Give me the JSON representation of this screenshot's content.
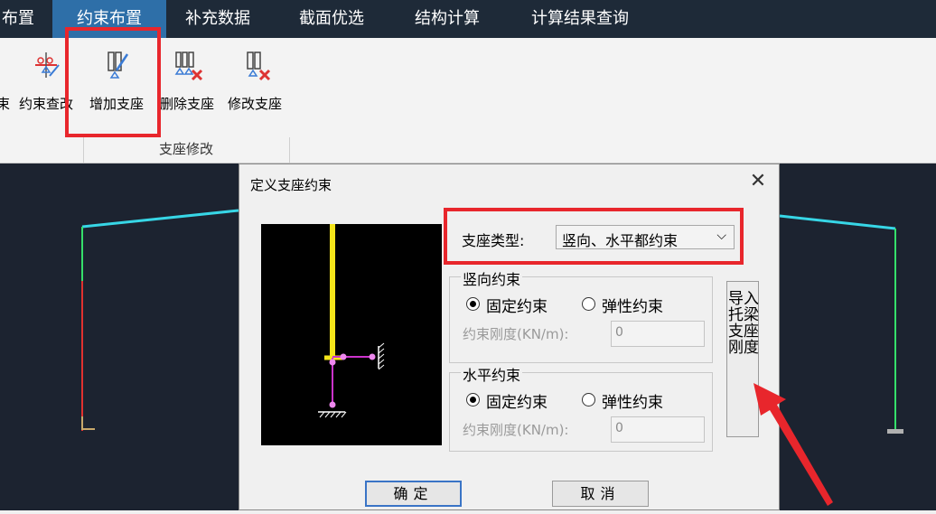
{
  "menubar": {
    "tabs": [
      {
        "label": "布置"
      },
      {
        "label": "约束布置"
      },
      {
        "label": "补充数据"
      },
      {
        "label": "截面优选"
      },
      {
        "label": "结构计算"
      },
      {
        "label": "计算结果查询"
      }
    ]
  },
  "ribbon": {
    "buttons": [
      {
        "label": "束"
      },
      {
        "label": "约束查改"
      },
      {
        "label": "增加支座"
      },
      {
        "label": "删除支座"
      },
      {
        "label": "修改支座"
      }
    ],
    "group_label": "支座修改"
  },
  "dialog": {
    "title": "定义支座约束",
    "support_type_label": "支座类型:",
    "support_type_value": "竖向、水平都约束",
    "vertical": {
      "title": "竖向约束",
      "fixed_label": "固定约束",
      "elastic_label": "弹性约束",
      "stiffness_label": "约束刚度(KN/m):",
      "stiffness_value": "0"
    },
    "horizontal": {
      "title": "水平约束",
      "fixed_label": "固定约束",
      "elastic_label": "弹性约束",
      "stiffness_label": "约束刚度(KN/m):",
      "stiffness_value": "0"
    },
    "import_button": "导入托梁支座刚度",
    "ok_button": "确定",
    "cancel_button": "取消"
  },
  "colors": {
    "highlight": "#e8262c",
    "menubar_bg": "#1e2a38",
    "active_tab": "#2e6fa8",
    "canvas_bg": "#1c2330",
    "beam": "#37d6e6",
    "column_left_top": "#35e06a",
    "column_left_bottom": "#e0312f",
    "preview_column": "#f5e51a",
    "preview_support": "#cc33cc"
  }
}
